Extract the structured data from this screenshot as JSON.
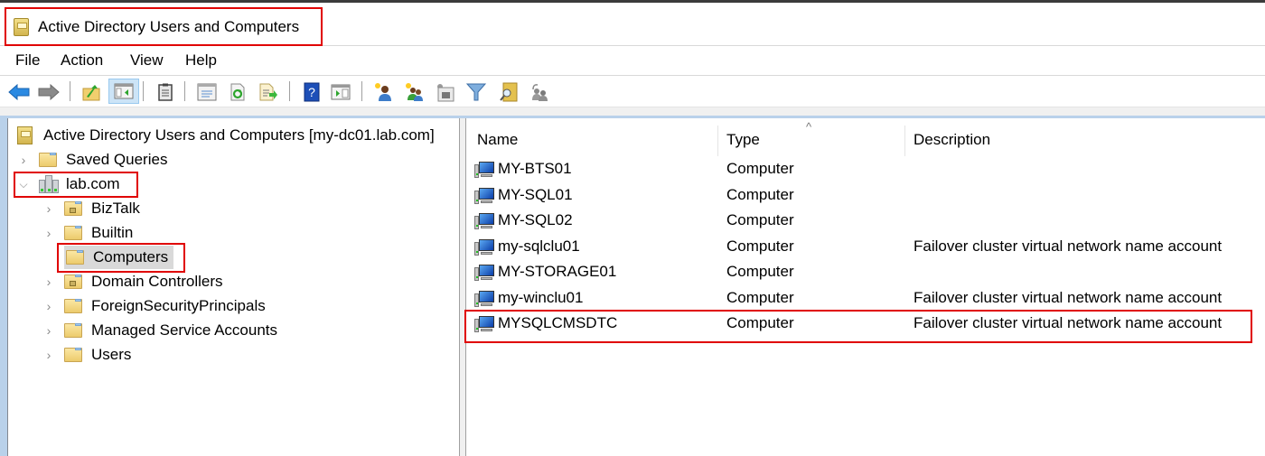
{
  "window": {
    "title": "Active Directory Users and Computers",
    "app_icon": "mmc-snapin-book-icon"
  },
  "menubar": {
    "items": [
      "File",
      "Action",
      "View",
      "Help"
    ]
  },
  "toolbar": {
    "buttons": [
      {
        "icon": "back-arrow-icon",
        "label": "Back"
      },
      {
        "icon": "forward-arrow-icon",
        "label": "Forward"
      },
      {
        "icon": "up-one-level-icon",
        "label": "Up one level"
      },
      {
        "icon": "show-hide-console-tree-icon",
        "label": "Show/Hide Console Tree",
        "active": true
      },
      {
        "icon": "clipboard-icon",
        "label": "Paste"
      },
      {
        "icon": "properties-icon",
        "label": "Properties"
      },
      {
        "icon": "refresh-icon",
        "label": "Refresh"
      },
      {
        "icon": "export-list-icon",
        "label": "Export List"
      },
      {
        "icon": "help-icon",
        "label": "Help"
      },
      {
        "icon": "show-hide-action-pane-icon",
        "label": "Show/Hide Action Pane"
      },
      {
        "icon": "new-user-icon",
        "label": "Create a new user"
      },
      {
        "icon": "new-group-icon",
        "label": "Create a new group"
      },
      {
        "icon": "new-ou-icon",
        "label": "Create a new organizational unit"
      },
      {
        "icon": "filter-icon",
        "label": "Filter"
      },
      {
        "icon": "find-icon",
        "label": "Find"
      },
      {
        "icon": "add-to-group-icon",
        "label": "Add to group"
      }
    ]
  },
  "tree": {
    "root": "Active Directory Users and Computers [my-dc01.lab.com]",
    "saved_queries": "Saved Queries",
    "domain": "lab.com",
    "children": [
      {
        "label": "BizTalk",
        "type": "ou",
        "expandable": true
      },
      {
        "label": "Builtin",
        "type": "container",
        "expandable": true
      },
      {
        "label": "Computers",
        "type": "container",
        "expandable": false,
        "selected": true
      },
      {
        "label": "Domain Controllers",
        "type": "ou",
        "expandable": true
      },
      {
        "label": "ForeignSecurityPrincipals",
        "type": "container",
        "expandable": true
      },
      {
        "label": "Managed Service Accounts",
        "type": "container",
        "expandable": true
      },
      {
        "label": "Users",
        "type": "container",
        "expandable": true
      }
    ]
  },
  "list": {
    "columns": [
      "Name",
      "Type",
      "Description"
    ],
    "sort_indicator": "^",
    "rows": [
      {
        "name": "MY-BTS01",
        "type": "Computer",
        "description": ""
      },
      {
        "name": "MY-SQL01",
        "type": "Computer",
        "description": ""
      },
      {
        "name": "MY-SQL02",
        "type": "Computer",
        "description": ""
      },
      {
        "name": "my-sqlclu01",
        "type": "Computer",
        "description": "Failover cluster virtual network name account"
      },
      {
        "name": "MY-STORAGE01",
        "type": "Computer",
        "description": ""
      },
      {
        "name": "my-winclu01",
        "type": "Computer",
        "description": "Failover cluster virtual network name account"
      },
      {
        "name": "MYSQLCMSDTC",
        "type": "Computer",
        "description": "Failover cluster virtual network name account"
      }
    ]
  },
  "colors": {
    "highlight_border": "#e00000",
    "selection_bg": "#d9d9d9",
    "pane_accent": "#b9d1ea"
  }
}
